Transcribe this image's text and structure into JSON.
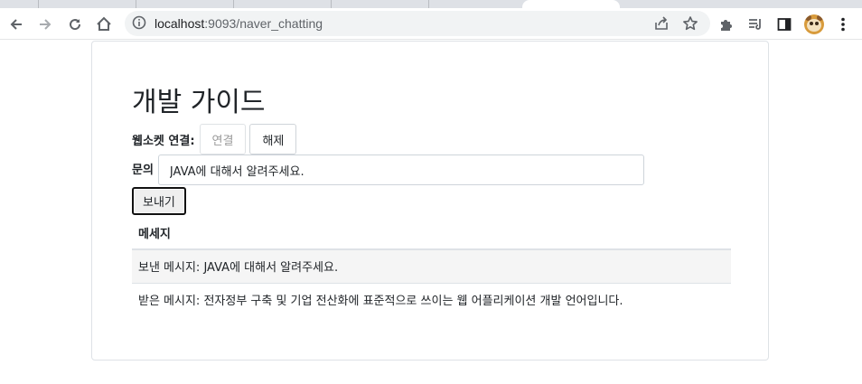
{
  "browser": {
    "url_host": "localhost",
    "url_rest": ":9093/naver_chatting"
  },
  "page": {
    "title": "개발 가이드",
    "websocket_label": "웹소켓 연결:",
    "connect_label": "연결",
    "disconnect_label": "해제",
    "question_label": "문의",
    "question_value": "JAVA에 대해서 알려주세요.",
    "send_label": "보내기",
    "table_header": "메세지",
    "messages": [
      "보낸 메시지: JAVA에 대해서 알려주세요.",
      "받은 메시지: 전자정부 구축 및 기업 전산화에 표준적으로 쓰이는 웹 어플리케이션 개발 언어입니다."
    ]
  }
}
